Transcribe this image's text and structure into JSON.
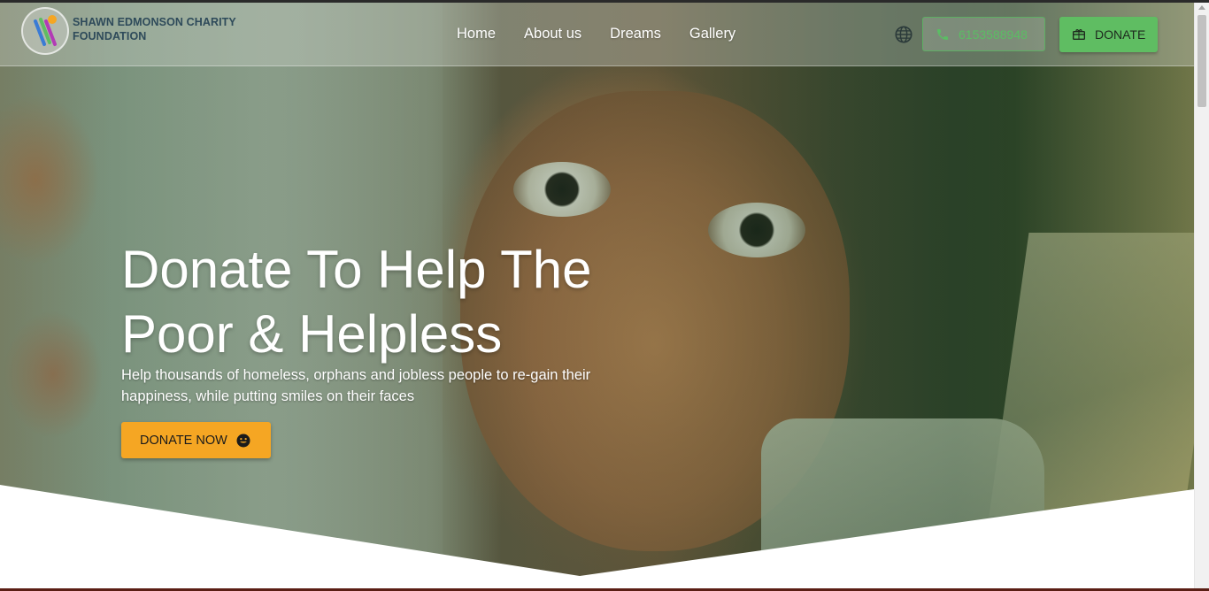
{
  "brand": {
    "line1": "SHAWN EDMONSON CHARITY",
    "line2": "FOUNDATION",
    "logo_icon": "foundation-logo-icon"
  },
  "nav": {
    "items": [
      {
        "label": "Home"
      },
      {
        "label": "About us"
      },
      {
        "label": "Dreams"
      },
      {
        "label": "Gallery"
      }
    ]
  },
  "header_actions": {
    "language_icon": "globe-icon",
    "phone": {
      "icon": "phone-icon",
      "label": "6153588948"
    },
    "donate": {
      "icon": "gift-card-icon",
      "label": "DONATE"
    }
  },
  "hero": {
    "title_line1": "Donate To Help The",
    "title_line2": "Poor & Helpless",
    "subtitle": "Help thousands of homeless, orphans and jobless people to re-gain their happiness, while putting smiles on their faces",
    "cta": {
      "label": "DONATE NOW",
      "icon": "smile-icon"
    }
  },
  "colors": {
    "accent_green": "#5fbd62",
    "cta_orange": "#f5a623",
    "brand_text": "#2e4a5a"
  }
}
